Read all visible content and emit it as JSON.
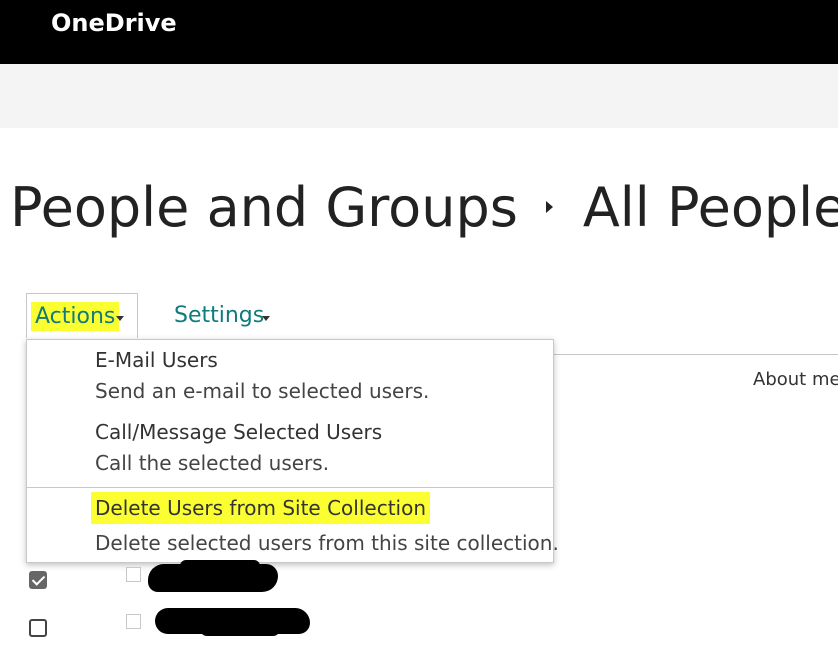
{
  "app": {
    "title": "OneDrive"
  },
  "page": {
    "breadcrumb": [
      "People and Groups",
      "All People"
    ]
  },
  "toolbar": {
    "actions_label": "Actions",
    "settings_label": "Settings"
  },
  "list": {
    "column_header": "About me"
  },
  "actions_menu": {
    "items": [
      {
        "title": "E-Mail Users",
        "description": "Send an e-mail to selected users."
      },
      {
        "title": "Call/Message Selected Users",
        "description": "Call the selected users."
      },
      {
        "title": "Delete Users from Site Collection",
        "description": "Delete selected users from this site collection."
      }
    ]
  },
  "rows": [
    {
      "selected": true,
      "name": "[redacted]"
    },
    {
      "selected": false,
      "name": "[redacted]"
    }
  ],
  "colors": {
    "topbar": "#000000",
    "link": "#0f7b7b",
    "highlight": "#fbff32",
    "subbar": "#f4f4f4"
  }
}
